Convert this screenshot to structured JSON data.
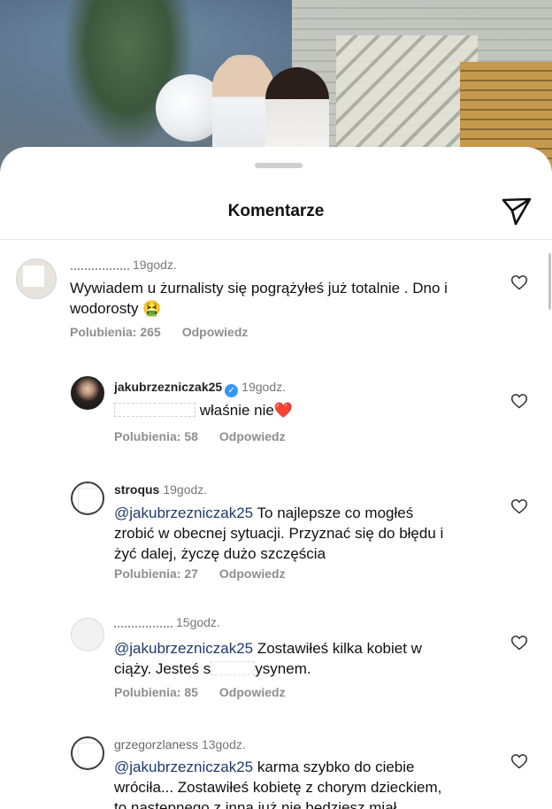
{
  "header": {
    "title": "Komentarze"
  },
  "comments": [
    {
      "time": "19godz.",
      "text": "Wywiadem u żurnalisty się pogrążyłeś już totalnie . Dno i wodorosty",
      "emoji": "🤮",
      "likes": "Polubienia: 265",
      "reply": "Odpowiedz"
    },
    {
      "username": "jakubrzezniczak25",
      "verified": true,
      "time": "19godz.",
      "text_after_mention": "właśnie nie",
      "emoji": "❤️",
      "likes": "Polubienia: 58",
      "reply": "Odpowiedz"
    },
    {
      "username": "stroqus",
      "time": "19godz.",
      "mention": "@jakubrzezniczak25",
      "line1": "To najlepsze co mogłeś",
      "line2": "zrobić w obecnej sytuacji. Przyznać się do błędu i",
      "line3": "żyć dalej, życzę dużo szczęścia",
      "likes": "Polubienia: 27",
      "reply": "Odpowiedz"
    },
    {
      "time": "15godz.",
      "mention": "@jakubrzezniczak25",
      "line1": "Zostawiłeś kilka kobiet w",
      "line2a": "ciąży. Jesteś s",
      "line2b": "ysynem.",
      "likes": "Polubienia: 85",
      "reply": "Odpowiedz"
    },
    {
      "username": "grzegorzlaness",
      "time": "13godz.",
      "mention": "@jakubrzezniczak25",
      "line1": "karma szybko do ciebie",
      "line2": "wróciła... Zostawiłeś kobietę z chorym dzieckiem,",
      "line3": "to następnego z inną już nie będziesz miał"
    }
  ]
}
